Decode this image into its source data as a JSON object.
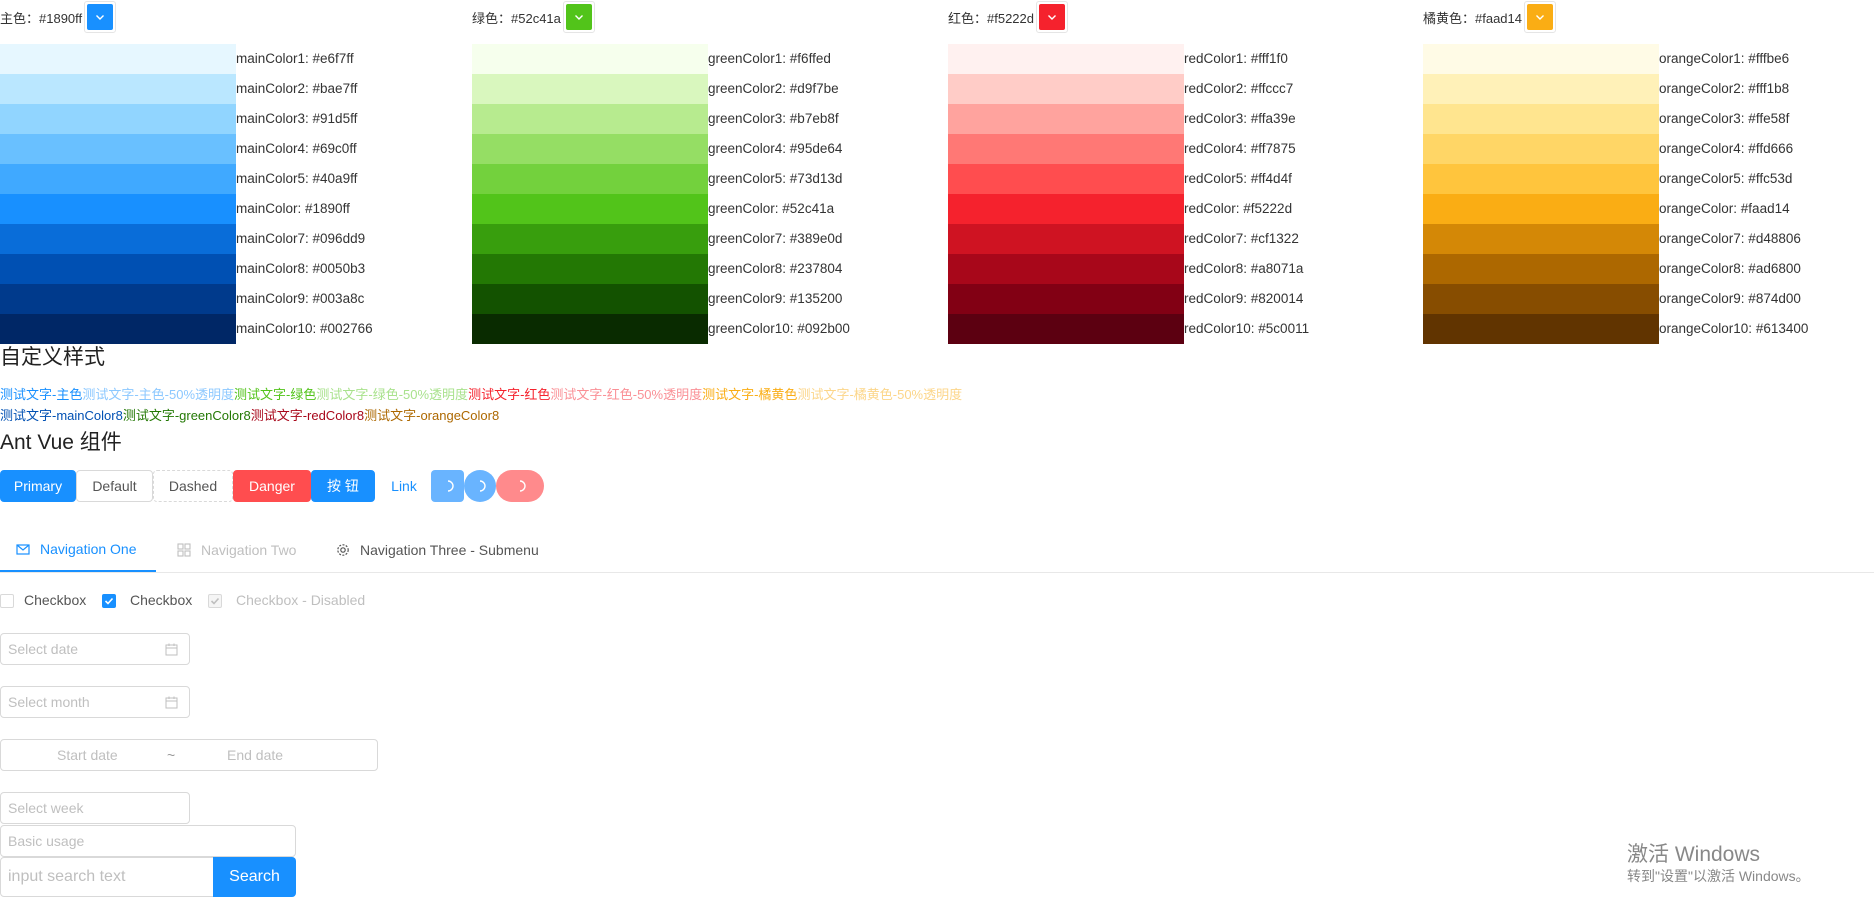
{
  "palettes": [
    {
      "header": "主色：#1890ff",
      "color": "#1890ff",
      "swatches": [
        {
          "label": "mainColor1: #e6f7ff",
          "hex": "#e6f7ff"
        },
        {
          "label": "mainColor2: #bae7ff",
          "hex": "#bae7ff"
        },
        {
          "label": "mainColor3: #91d5ff",
          "hex": "#91d5ff"
        },
        {
          "label": "mainColor4: #69c0ff",
          "hex": "#69c0ff"
        },
        {
          "label": "mainColor5: #40a9ff",
          "hex": "#40a9ff"
        },
        {
          "label": "mainColor: #1890ff",
          "hex": "#1890ff"
        },
        {
          "label": "mainColor7: #096dd9",
          "hex": "#096dd9"
        },
        {
          "label": "mainColor8: #0050b3",
          "hex": "#0050b3"
        },
        {
          "label": "mainColor9: #003a8c",
          "hex": "#003a8c"
        },
        {
          "label": "mainColor10: #002766",
          "hex": "#002766"
        }
      ]
    },
    {
      "header": "绿色：#52c41a",
      "color": "#52c41a",
      "swatches": [
        {
          "label": "greenColor1: #f6ffed",
          "hex": "#f6ffed"
        },
        {
          "label": "greenColor2: #d9f7be",
          "hex": "#d9f7be"
        },
        {
          "label": "greenColor3: #b7eb8f",
          "hex": "#b7eb8f"
        },
        {
          "label": "greenColor4: #95de64",
          "hex": "#95de64"
        },
        {
          "label": "greenColor5: #73d13d",
          "hex": "#73d13d"
        },
        {
          "label": "greenColor: #52c41a",
          "hex": "#52c41a"
        },
        {
          "label": "greenColor7: #389e0d",
          "hex": "#389e0d"
        },
        {
          "label": "greenColor8: #237804",
          "hex": "#237804"
        },
        {
          "label": "greenColor9: #135200",
          "hex": "#135200"
        },
        {
          "label": "greenColor10: #092b00",
          "hex": "#092b00"
        }
      ]
    },
    {
      "header": "红色：#f5222d",
      "color": "#f5222d",
      "swatches": [
        {
          "label": "redColor1: #fff1f0",
          "hex": "#fff1f0"
        },
        {
          "label": "redColor2: #ffccc7",
          "hex": "#ffccc7"
        },
        {
          "label": "redColor3: #ffa39e",
          "hex": "#ffa39e"
        },
        {
          "label": "redColor4: #ff7875",
          "hex": "#ff7875"
        },
        {
          "label": "redColor5: #ff4d4f",
          "hex": "#ff4d4f"
        },
        {
          "label": "redColor: #f5222d",
          "hex": "#f5222d"
        },
        {
          "label": "redColor7: #cf1322",
          "hex": "#cf1322"
        },
        {
          "label": "redColor8: #a8071a",
          "hex": "#a8071a"
        },
        {
          "label": "redColor9: #820014",
          "hex": "#820014"
        },
        {
          "label": "redColor10: #5c0011",
          "hex": "#5c0011"
        }
      ]
    },
    {
      "header": "橘黄色：#faad14",
      "color": "#faad14",
      "swatches": [
        {
          "label": "orangeColor1: #fffbe6",
          "hex": "#fffbe6"
        },
        {
          "label": "orangeColor2: #fff1b8",
          "hex": "#fff1b8"
        },
        {
          "label": "orangeColor3: #ffe58f",
          "hex": "#ffe58f"
        },
        {
          "label": "orangeColor4: #ffd666",
          "hex": "#ffd666"
        },
        {
          "label": "orangeColor5: #ffc53d",
          "hex": "#ffc53d"
        },
        {
          "label": "orangeColor: #faad14",
          "hex": "#faad14"
        },
        {
          "label": "orangeColor7: #d48806",
          "hex": "#d48806"
        },
        {
          "label": "orangeColor8: #ad6800",
          "hex": "#ad6800"
        },
        {
          "label": "orangeColor9: #874d00",
          "hex": "#874d00"
        },
        {
          "label": "orangeColor10: #613400",
          "hex": "#613400"
        }
      ]
    }
  ],
  "custom": {
    "title": "自定义样式",
    "line1": [
      {
        "text": "测试文字-主色",
        "color": "#1890ff"
      },
      {
        "text": "测试文字-主色-50%透明度",
        "color": "#8cc8ff"
      },
      {
        "text": "测试文字-绿色",
        "color": "#52c41a"
      },
      {
        "text": "测试文字-绿色-50%透明度",
        "color": "#a9e28d"
      },
      {
        "text": "测试文字-红色",
        "color": "#f5222d"
      },
      {
        "text": "测试文字-红色-50%透明度",
        "color": "#fa9096"
      },
      {
        "text": "测试文字-橘黄色",
        "color": "#faad14"
      },
      {
        "text": "测试文字-橘黄色-50%透明度",
        "color": "#fcd68a"
      }
    ],
    "line2": [
      {
        "text": "测试文字-mainColor8",
        "color": "#0050b3"
      },
      {
        "text": "测试文字-greenColor8",
        "color": "#237804"
      },
      {
        "text": "测试文字-redColor8",
        "color": "#a8071a"
      },
      {
        "text": "测试文字-orangeColor8",
        "color": "#ad6800"
      }
    ]
  },
  "antv": {
    "title": "Ant Vue 组件",
    "buttons": {
      "primary": "Primary",
      "default": "Default",
      "dashed": "Dashed",
      "danger": "Danger",
      "chinese": "按 钮",
      "link": "Link"
    },
    "menu": {
      "one": "Navigation One",
      "two": "Navigation Two",
      "three": "Navigation Three - Submenu"
    },
    "checkboxes": {
      "unchecked": "Checkbox",
      "checked": "Checkbox",
      "disabled": "Checkbox - Disabled"
    },
    "pickers": {
      "date": "Select date",
      "month": "Select month",
      "start": "Start date",
      "sep": "~",
      "end": "End date",
      "week": "Select week"
    },
    "inputs": {
      "basic": "Basic usage",
      "search_placeholder": "input search text",
      "search_button": "Search"
    }
  },
  "watermark": {
    "line1": "激活 Windows",
    "line2": "转到\"设置\"以激活 Windows。"
  }
}
